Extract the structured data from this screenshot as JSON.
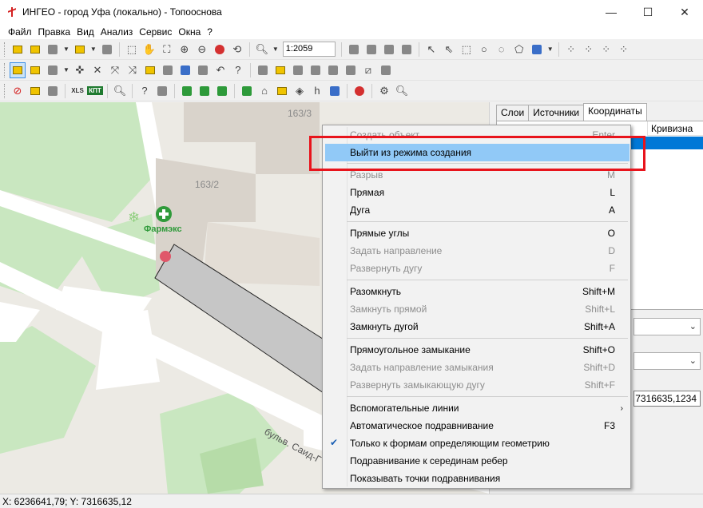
{
  "window": {
    "title": "ИНГЕО - город Уфа (локально) - Топооснова",
    "minimize": "—",
    "maximize": "☐",
    "close": "✕"
  },
  "menubar": [
    "Файл",
    "Правка",
    "Вид",
    "Анализ",
    "Сервис",
    "Окна",
    "?"
  ],
  "toolbar": {
    "scale_value": "1:2059",
    "xls_label": "XLS",
    "kpt_label": "КПТ"
  },
  "map": {
    "labels": {
      "building1": "163/3",
      "building2": "163/2",
      "pharmacy": "Фармэкс",
      "street": "бульв. Саид-Г"
    },
    "colors": {
      "background": "#eceae4",
      "green": "#c9e7c0",
      "road": "#ffffff",
      "building": "#d9d3cb",
      "polygon": "#c6c6c6",
      "pharmacy": "#2f9a3a"
    }
  },
  "panel": {
    "tabs": [
      "Слои",
      "Источники",
      "Координаты"
    ],
    "active_tab": "Координаты",
    "column_header": "Кривизна",
    "coord_value": "7316635,1234"
  },
  "statusbar": {
    "coords": "X: 6236641,79; Y: 7316635,12"
  },
  "context_menu": {
    "items": [
      {
        "label": "Создать объект",
        "shortcut": "Enter",
        "disabled": true
      },
      {
        "label": "Выйти из режима создания",
        "shortcut": "",
        "disabled": false,
        "highlighted": true
      },
      {
        "label": "Разрыв",
        "shortcut": "M",
        "disabled": true
      },
      {
        "label": "Прямая",
        "shortcut": "L",
        "disabled": false
      },
      {
        "label": "Дуга",
        "shortcut": "A",
        "disabled": false
      },
      {
        "label": "Прямые углы",
        "shortcut": "O",
        "disabled": false
      },
      {
        "label": "Задать направление",
        "shortcut": "D",
        "disabled": true
      },
      {
        "label": "Развернуть дугу",
        "shortcut": "F",
        "disabled": true
      },
      {
        "label": "Разомкнуть",
        "shortcut": "Shift+M",
        "disabled": false
      },
      {
        "label": "Замкнуть прямой",
        "shortcut": "Shift+L",
        "disabled": true
      },
      {
        "label": "Замкнуть дугой",
        "shortcut": "Shift+A",
        "disabled": false
      },
      {
        "label": "Прямоугольное замыкание",
        "shortcut": "Shift+O",
        "disabled": false
      },
      {
        "label": "Задать направление замыкания",
        "shortcut": "Shift+D",
        "disabled": true
      },
      {
        "label": "Развернуть замыкающую дугу",
        "shortcut": "Shift+F",
        "disabled": true
      },
      {
        "label": "Вспомогательные линии",
        "shortcut": "",
        "disabled": false,
        "submenu": true
      },
      {
        "label": "Автоматическое подравнивание",
        "shortcut": "F3",
        "disabled": false
      },
      {
        "label": "Только к формам определяющим геометрию",
        "shortcut": "",
        "disabled": false,
        "checked": true
      },
      {
        "label": "Подравнивание к серединам ребер",
        "shortcut": "",
        "disabled": false
      },
      {
        "label": "Показывать точки подравнивания",
        "shortcut": "",
        "disabled": false
      }
    ],
    "submenu_arrow": "›",
    "check_mark": "✔"
  },
  "annotation": {
    "color": "#e8141c"
  }
}
